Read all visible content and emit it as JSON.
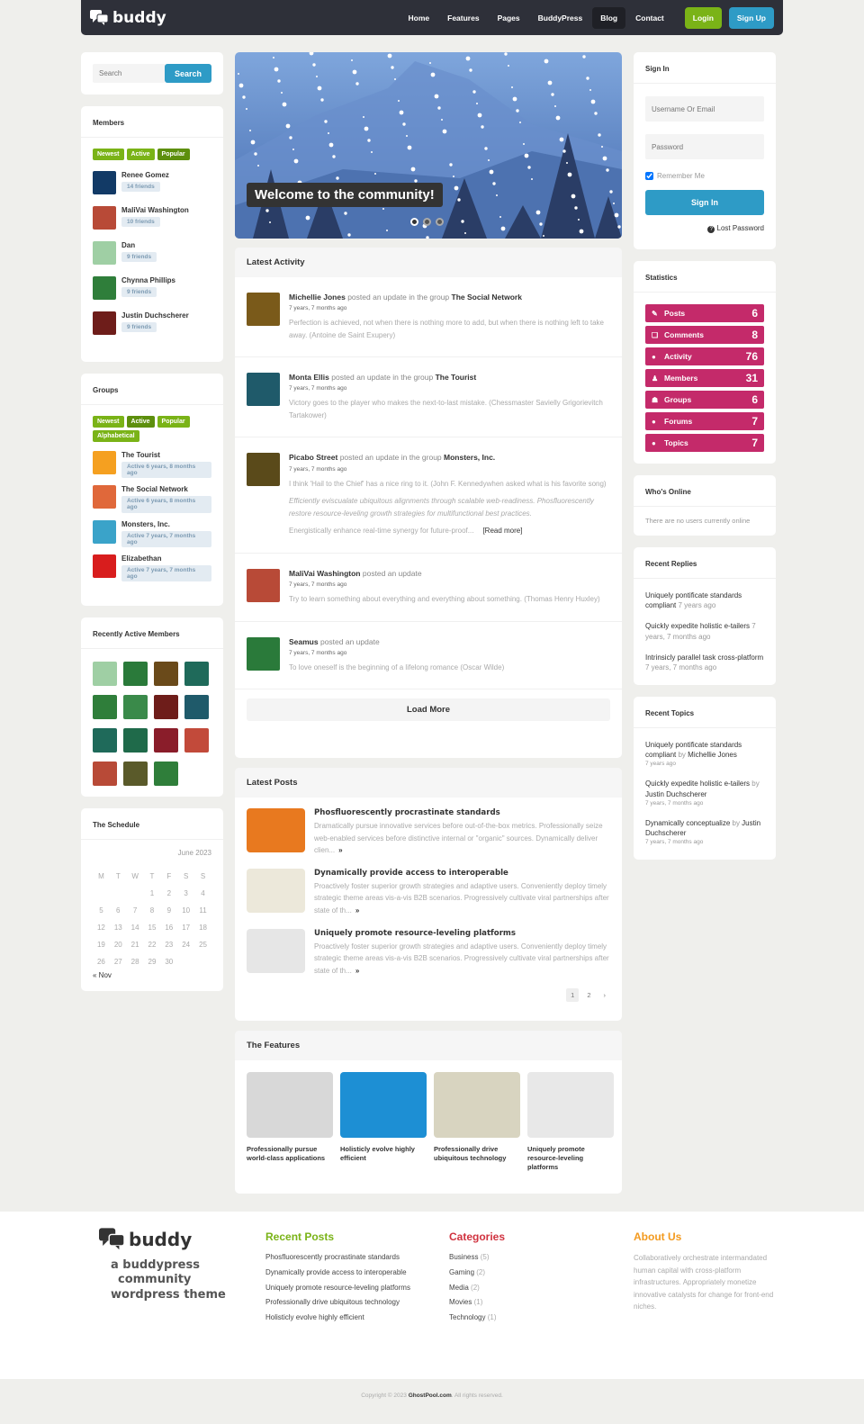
{
  "header": {
    "logo": "buddy",
    "nav": [
      "Home",
      "Features",
      "Pages",
      "BuddyPress",
      "Blog",
      "Contact"
    ],
    "active_nav": "Blog",
    "login": "Login",
    "signup": "Sign Up"
  },
  "search": {
    "placeholder": "Search",
    "button": "Search"
  },
  "members": {
    "title": "Members",
    "tabs": [
      "Newest",
      "Active",
      "Popular"
    ],
    "active_tab": "Popular",
    "items": [
      {
        "name": "Renee Gomez",
        "friends": "14 friends",
        "color": "#123a66"
      },
      {
        "name": "MaliVai Washington",
        "friends": "10 friends",
        "color": "#b84a37"
      },
      {
        "name": "Dan",
        "friends": "9 friends",
        "color": "#9fcfa4"
      },
      {
        "name": "Chynna Phillips",
        "friends": "9 friends",
        "color": "#2f7e3a"
      },
      {
        "name": "Justin Duchscherer",
        "friends": "9 friends",
        "color": "#6e1d1a"
      }
    ]
  },
  "groups": {
    "title": "Groups",
    "tabs": [
      "Newest",
      "Active",
      "Popular",
      "Alphabetical"
    ],
    "active_tab": "Active",
    "items": [
      {
        "name": "The Tourist",
        "active": "Active 6 years, 8 months ago",
        "color": "#f5a020"
      },
      {
        "name": "The Social Network",
        "active": "Active 6 years, 8 months ago",
        "color": "#e0683a"
      },
      {
        "name": "Monsters, Inc.",
        "active": "Active 7 years, 7 months ago",
        "color": "#3aa3c9"
      },
      {
        "name": "Elizabethan",
        "active": "Active 7 years, 7 months ago",
        "color": "#d81d1d"
      }
    ]
  },
  "recently_active": {
    "title": "Recently Active Members",
    "avatars": [
      "#9fcfa4",
      "#2a7a3a",
      "#6a4a1a",
      "#1f6a5a",
      "#2f7e3a",
      "#3a8a4a",
      "#6e1d1a",
      "#1f5a6a",
      "#1f6a5a",
      "#1f6a4a",
      "#8a1d2a",
      "#c24a3a",
      "#b84a37",
      "#5a5a2a",
      "#2f7e3a"
    ]
  },
  "schedule": {
    "title": "The Schedule",
    "month": "June 2023",
    "weekdays": [
      "M",
      "T",
      "W",
      "T",
      "F",
      "S",
      "S"
    ],
    "weeks": [
      [
        "",
        "",
        "",
        "1",
        "2",
        "3",
        "4"
      ],
      [
        "5",
        "6",
        "7",
        "8",
        "9",
        "10",
        "11"
      ],
      [
        "12",
        "13",
        "14",
        "15",
        "16",
        "17",
        "18"
      ],
      [
        "19",
        "20",
        "21",
        "22",
        "23",
        "24",
        "25"
      ],
      [
        "26",
        "27",
        "28",
        "29",
        "30",
        "",
        ""
      ]
    ],
    "prev": "« Nov"
  },
  "slider": {
    "caption": "Welcome to the community!",
    "slides": 3,
    "current": 1
  },
  "activity": {
    "title": "Latest Activity",
    "items": [
      {
        "user": "Michellie Jones",
        "action": " posted an update in the group ",
        "group": "The Social Network",
        "time": "7 years, 7 months ago",
        "text": "Perfection is achieved, not when there is nothing more to add, but when there is nothing left to take away. (Antoine de Saint Exupery)",
        "color": "#7a5a1a"
      },
      {
        "user": "Monta Ellis",
        "action": " posted an update in the group ",
        "group": "The Tourist",
        "time": "7 years, 7 months ago",
        "text": "Victory goes to the player who makes the next-to-last mistake. (Chessmaster Savielly Grigorievitch Tartakower)",
        "color": "#1f5a6a"
      },
      {
        "user": "Picabo Street",
        "action": " posted an update in the group ",
        "group": "Monsters, Inc.",
        "time": "7 years, 7 months ago",
        "text": "I think 'Hail to the Chief' has a nice ring to it. (John F. Kennedywhen asked what is his favorite song)",
        "italic": "Efficiently eviscualate ubiquitous alignments through scalable web-readiness. Phosfluorescently restore resource-leveling growth strategies for multifunctional best practices.",
        "more": "Energistically enhance real-time synergy for future-proof...",
        "read_more": "[Read more]",
        "color": "#5a4a1a"
      },
      {
        "user": "MaliVai Washington",
        "action": " posted an update",
        "group": "",
        "time": "7 years, 7 months ago",
        "text": "Try to learn something about everything and everything about something. (Thomas Henry Huxley)",
        "color": "#b84a37"
      },
      {
        "user": "Seamus",
        "action": " posted an update",
        "group": "",
        "time": "7 years, 7 months ago",
        "text": "To love oneself is the beginning of a lifelong romance (Oscar Wilde)",
        "color": "#2a7a3a"
      }
    ],
    "load_more": "Load More"
  },
  "posts": {
    "title": "Latest Posts",
    "items": [
      {
        "title": "Phosfluorescently procrastinate standards",
        "excerpt": "Dramatically pursue innovative services before out-of-the-box metrics. Professionally seize web-enabled services before distinctive internal or \"organic\" sources. Dynamically deliver clien...",
        "color": "#e8791f"
      },
      {
        "title": "Dynamically provide access to interoperable",
        "excerpt": "Proactively foster superior growth strategies and adaptive users. Conveniently deploy timely strategic theme areas vis-a-vis B2B scenarios. Progressively cultivate viral partnerships after state of th...",
        "color": "#ece8da"
      },
      {
        "title": "Uniquely promote resource-leveling platforms",
        "excerpt": "Proactively foster superior growth strategies and adaptive users. Conveniently deploy timely strategic theme areas vis-a-vis B2B scenarios. Progressively cultivate viral partnerships after state of th...",
        "color": "#e6e6e6"
      }
    ],
    "more_glyph": "»",
    "pages": [
      "1",
      "2",
      "›"
    ],
    "current_page": "1"
  },
  "features": {
    "title": "The Features",
    "items": [
      {
        "caption": "Professionally pursue world-class applications",
        "color": "#d8d8d8"
      },
      {
        "caption": "Holisticly evolve highly efficient",
        "color": "#1d8fd4"
      },
      {
        "caption": "Professionally drive ubiquitous technology",
        "color": "#d8d4c0"
      },
      {
        "caption": "Uniquely promote resource-leveling platforms",
        "color": "#e8e8e8"
      }
    ]
  },
  "signin": {
    "title": "Sign In",
    "username_placeholder": "Username Or Email",
    "password_placeholder": "Password",
    "remember": "Remember Me",
    "remember_checked": true,
    "button": "Sign In",
    "lost": "Lost Password"
  },
  "statistics": {
    "title": "Statistics",
    "color": "#c42a6a",
    "items": [
      {
        "label": "Posts",
        "value": "6",
        "icon": "✎"
      },
      {
        "label": "Comments",
        "value": "8",
        "icon": "❏"
      },
      {
        "label": "Activity",
        "value": "76",
        "icon": "●"
      },
      {
        "label": "Members",
        "value": "31",
        "icon": "♟"
      },
      {
        "label": "Groups",
        "value": "6",
        "icon": "☗"
      },
      {
        "label": "Forums",
        "value": "7",
        "icon": "●"
      },
      {
        "label": "Topics",
        "value": "7",
        "icon": "●"
      }
    ]
  },
  "online": {
    "title": "Who's Online",
    "text": "There are no users currently online"
  },
  "replies": {
    "title": "Recent Replies",
    "items": [
      {
        "title": "Uniquely pontificate standards compliant",
        "time": " 7 years ago"
      },
      {
        "title": "Quickly expedite holistic e-tailers",
        "time": " 7 years, 7 months ago"
      },
      {
        "title": "Intrinsicly parallel task cross-platform",
        "time": " 7 years, 7 months ago"
      }
    ]
  },
  "topics": {
    "title": "Recent Topics",
    "items": [
      {
        "title": "Uniquely pontificate standards compliant",
        "by": " by ",
        "author": "Michellie Jones",
        "time": "7 years ago"
      },
      {
        "title": "Quickly expedite holistic e-tailers",
        "by": " by ",
        "author": "Justin Duchscherer",
        "time": "7 years, 7 months ago"
      },
      {
        "title": "Dynamically conceptualize",
        "by": " by ",
        "author": "Justin Duchscherer",
        "time": "7 years, 7 months ago"
      }
    ]
  },
  "footer": {
    "logo": "buddy",
    "tagline": [
      "a buddypress",
      "community",
      "wordpress theme"
    ],
    "recent_posts": {
      "title": "Recent Posts",
      "color": "#7ab317",
      "items": [
        "Phosfluorescently procrastinate standards",
        "Dynamically provide access to interoperable",
        "Uniquely promote resource-leveling platforms",
        "Professionally drive ubiquitous technology",
        "Holisticly evolve highly efficient"
      ]
    },
    "categories": {
      "title": "Categories",
      "color": "#d0323f",
      "items": [
        {
          "name": "Business",
          "count": "(5)"
        },
        {
          "name": "Gaming",
          "count": "(2)"
        },
        {
          "name": "Media",
          "count": "(2)"
        },
        {
          "name": "Movies",
          "count": "(1)"
        },
        {
          "name": "Technology",
          "count": "(1)"
        }
      ]
    },
    "about": {
      "title": "About Us",
      "color": "#f39a1e",
      "text": "Collaboratively orchestrate intermandated human capital with cross-platform infrastructures. Appropriately monetize innovative catalysts for change for front-end niches."
    },
    "copyright_pre": "Copyright © 2023 ",
    "copyright_link": "GhostPool.com",
    "copyright_post": ". All rights reserved."
  }
}
